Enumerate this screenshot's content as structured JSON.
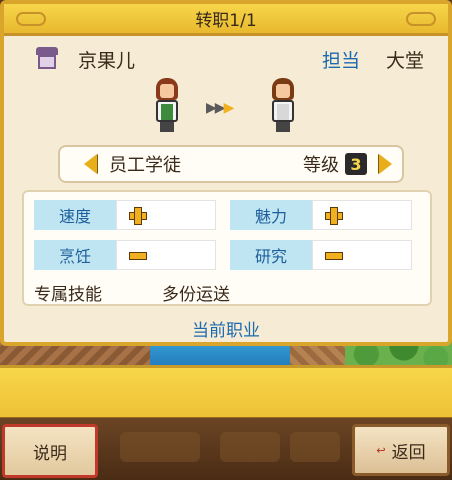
{
  "dialog": {
    "title": "转职1/1",
    "employee_name": "京果儿",
    "duty_label": "担当",
    "duty_value": "大堂",
    "job_name": "员工学徒",
    "level_label": "等级",
    "level_value": "3",
    "stats": [
      {
        "label": "速度",
        "change": "plus"
      },
      {
        "label": "魅力",
        "change": "plus"
      },
      {
        "label": "烹饪",
        "change": "minus"
      },
      {
        "label": "研究",
        "change": "minus"
      }
    ],
    "skill_label": "专属技能",
    "skill_value": "多份运送",
    "current_job_link": "当前职业"
  },
  "bottom_bar": {
    "explain_label": "说明",
    "close_label": "返回"
  },
  "icons": {
    "arrow": "▶"
  },
  "colors": {
    "title_bar": "#f7d64a",
    "panel_bg": "#f6ecd5",
    "stat_label_bg": "#bfe4f2",
    "link_blue": "#1c6ab0",
    "explain_border": "#c0392b"
  }
}
